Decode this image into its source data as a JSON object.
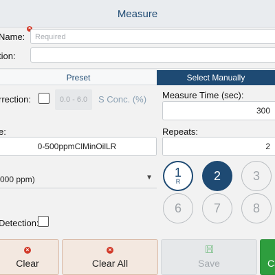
{
  "window": {
    "title": "Measure"
  },
  "form": {
    "name_label": "Name:",
    "name_placeholder": "Required",
    "description_label": "tion:",
    "description_value": ""
  },
  "tabs": {
    "preset": "Preset",
    "manual": "Select Manually"
  },
  "left": {
    "correction_label": "rrection:",
    "correction_checked": false,
    "range_value": "0.0 - 6.0",
    "concentration_label": "S Conc. (%)",
    "method_label": "e:",
    "method_value": "0-500ppmClMinOilLR",
    "dropdown_value": "000 ppm)",
    "detection_label": "Detection:",
    "detection_checked": false
  },
  "right": {
    "measure_time_label": "Measure Time (sec):",
    "measure_time_value": "300",
    "repeats_label": "Repeats:",
    "repeats_value": "2",
    "position_buttons": [
      {
        "label": "1",
        "sub": "R",
        "state": "current"
      },
      {
        "label": "2",
        "state": "selected"
      },
      {
        "label": "3",
        "state": "normal"
      },
      {
        "label": "6",
        "state": "normal"
      },
      {
        "label": "7",
        "state": "normal"
      },
      {
        "label": "8",
        "state": "normal"
      }
    ]
  },
  "footer": {
    "clear": "Clear",
    "clear_all": "Clear All",
    "save": "Save",
    "go": "Ca"
  },
  "colors": {
    "accent": "#1e4a73",
    "danger": "#d23b2b",
    "success": "#2e9e3e"
  }
}
